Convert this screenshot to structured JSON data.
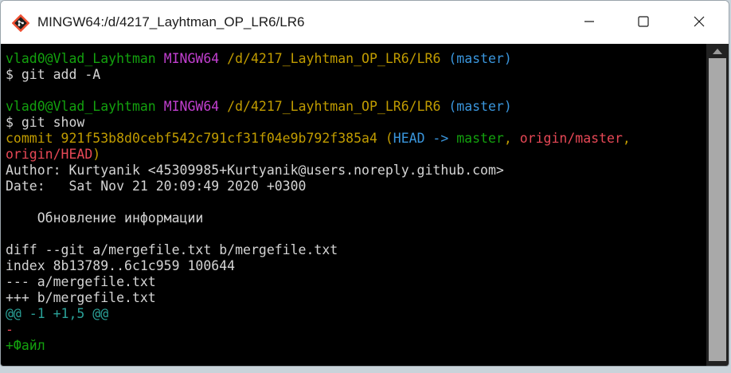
{
  "window": {
    "title": "MINGW64:/d/4217_Layhtman_OP_LR6/LR6",
    "controls": {
      "minimize": "minimize",
      "maximize": "maximize",
      "close": "close"
    }
  },
  "colors": {
    "user": "#13a10e",
    "env": "#c23fd0",
    "path": "#c19c00",
    "branch": "#3a96dd",
    "text": "#d4d4d4",
    "commit": "#c19c00",
    "head": "#3a96dd",
    "local": "#13a10e",
    "remote": "#e74856",
    "hunk": "#2aa198",
    "removed": "#e74856",
    "added": "#13a10e"
  },
  "terminal": {
    "lines": [
      {
        "segments": [
          {
            "text": "vlad0@Vlad_Layhtman",
            "color": "user"
          },
          {
            "text": " ",
            "color": "text"
          },
          {
            "text": "MINGW64",
            "color": "env"
          },
          {
            "text": " ",
            "color": "text"
          },
          {
            "text": "/d/4217_Layhtman_OP_LR6/LR6",
            "color": "path"
          },
          {
            "text": " ",
            "color": "text"
          },
          {
            "text": "(master)",
            "color": "branch"
          }
        ]
      },
      {
        "segments": [
          {
            "text": "$ git add -A",
            "color": "text"
          }
        ]
      },
      {
        "segments": []
      },
      {
        "segments": [
          {
            "text": "vlad0@Vlad_Layhtman",
            "color": "user"
          },
          {
            "text": " ",
            "color": "text"
          },
          {
            "text": "MINGW64",
            "color": "env"
          },
          {
            "text": " ",
            "color": "text"
          },
          {
            "text": "/d/4217_Layhtman_OP_LR6/LR6",
            "color": "path"
          },
          {
            "text": " ",
            "color": "text"
          },
          {
            "text": "(master)",
            "color": "branch"
          }
        ]
      },
      {
        "segments": [
          {
            "text": "$ git show",
            "color": "text"
          }
        ]
      },
      {
        "segments": [
          {
            "text": "commit 921f53b8d0cebf542c791cf31f04e9b792f385a4 (",
            "color": "commit"
          },
          {
            "text": "HEAD -> ",
            "color": "head"
          },
          {
            "text": "master",
            "color": "local"
          },
          {
            "text": ", ",
            "color": "commit"
          },
          {
            "text": "origin/master",
            "color": "remote"
          },
          {
            "text": ",",
            "color": "commit"
          }
        ]
      },
      {
        "segments": [
          {
            "text": "origin/HEAD",
            "color": "remote"
          },
          {
            "text": ")",
            "color": "commit"
          }
        ]
      },
      {
        "segments": [
          {
            "text": "Author: Kurtyanik <45309985+Kurtyanik@users.noreply.github.com>",
            "color": "text"
          }
        ]
      },
      {
        "segments": [
          {
            "text": "Date:   Sat Nov 21 20:09:49 2020 +0300",
            "color": "text"
          }
        ]
      },
      {
        "segments": []
      },
      {
        "segments": [
          {
            "text": "    Обновление информации",
            "color": "text"
          }
        ]
      },
      {
        "segments": []
      },
      {
        "segments": [
          {
            "text": "diff --git a/mergefile.txt b/mergefile.txt",
            "color": "text"
          }
        ]
      },
      {
        "segments": [
          {
            "text": "index 8b13789..6c1c959 100644",
            "color": "text"
          }
        ]
      },
      {
        "segments": [
          {
            "text": "--- a/mergefile.txt",
            "color": "text"
          }
        ]
      },
      {
        "segments": [
          {
            "text": "+++ b/mergefile.txt",
            "color": "text"
          }
        ]
      },
      {
        "segments": [
          {
            "text": "@@ -1 +1,5 @@",
            "color": "hunk"
          }
        ]
      },
      {
        "segments": [
          {
            "text": "-",
            "color": "removed"
          }
        ]
      },
      {
        "segments": [
          {
            "text": "+Файл",
            "color": "added"
          }
        ]
      }
    ]
  }
}
